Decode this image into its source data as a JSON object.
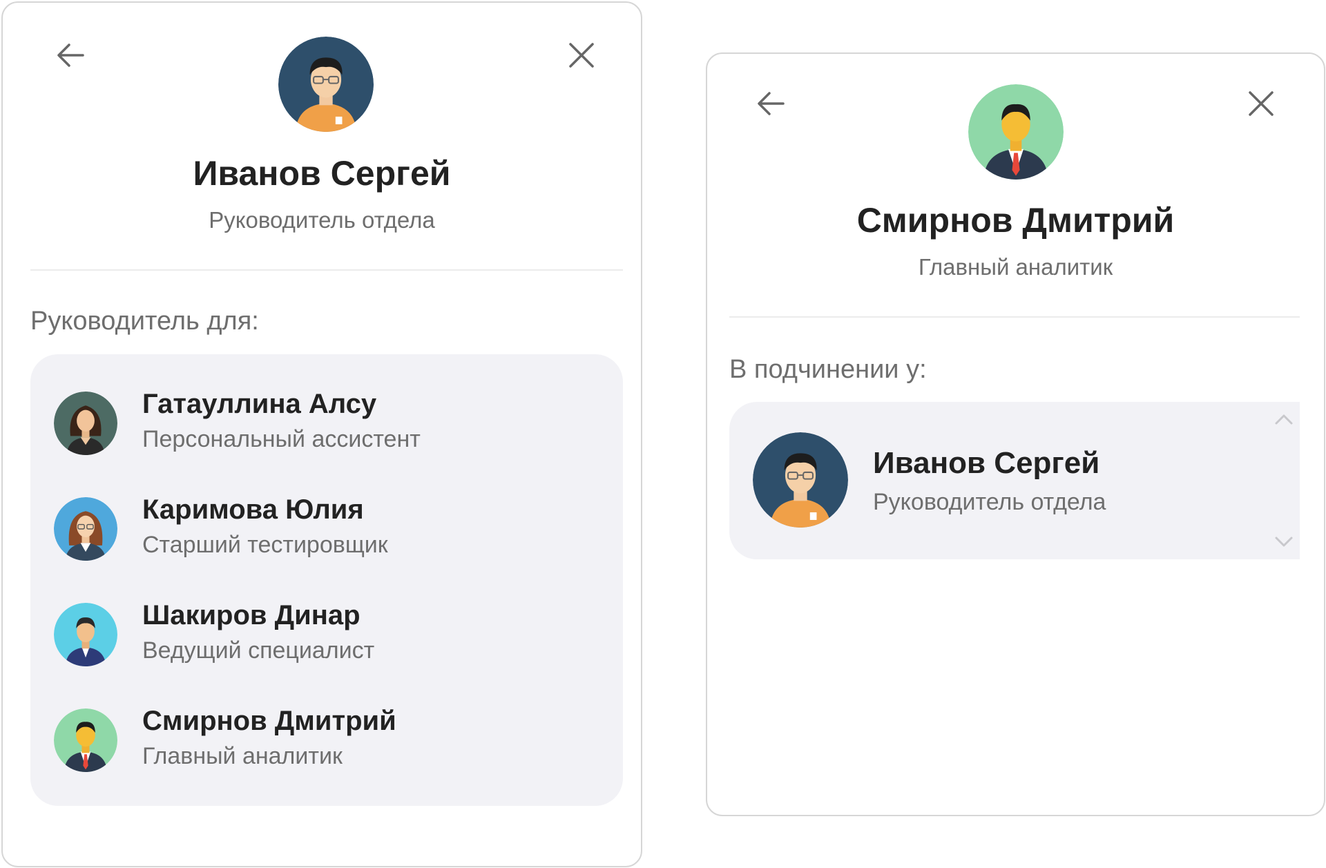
{
  "panel_left": {
    "name": "Иванов Сергей",
    "role": "Руководитель отдела",
    "section_label": "Руководитель для:",
    "items": [
      {
        "name": "Гатауллина Алсу",
        "role": "Персональный ассистент",
        "avatar": "female-assistant-avatar"
      },
      {
        "name": "Каримова Юлия",
        "role": "Старший тестировщик",
        "avatar": "female-glasses-avatar"
      },
      {
        "name": "Шакиров Динар",
        "role": "Ведущий специалист",
        "avatar": "male-specialist-avatar"
      },
      {
        "name": "Смирнов Дмитрий",
        "role": "Главный аналитик",
        "avatar": "male-suit-avatar"
      }
    ]
  },
  "panel_right": {
    "name": "Смирнов Дмитрий",
    "role": "Главный аналитик",
    "section_label": "В подчинении у:",
    "items": [
      {
        "name": "Иванов Сергей",
        "role": "Руководитель отдела",
        "avatar": "male-glasses-avatar"
      }
    ]
  },
  "icons": {
    "back": "arrow-left-icon",
    "close": "close-icon",
    "scroll_up": "chevron-up-icon",
    "scroll_down": "chevron-down-icon"
  },
  "colors": {
    "list_background": "#f2f2f6",
    "secondary_text": "#6e6e6e",
    "primary_text": "#222222"
  }
}
